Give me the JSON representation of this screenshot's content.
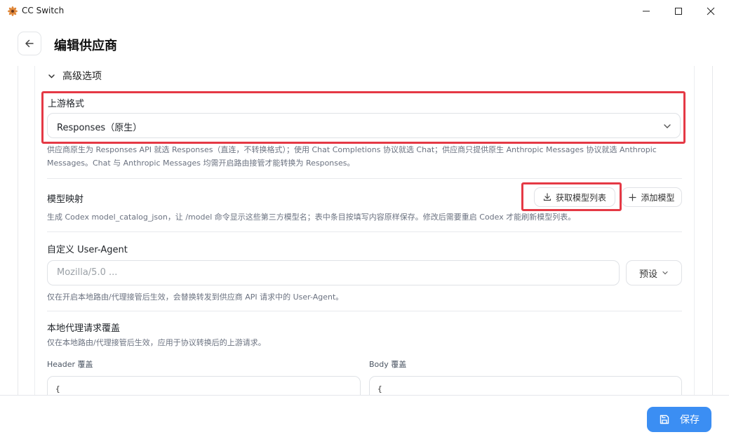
{
  "window": {
    "title": "CC Switch"
  },
  "header": {
    "title": "编辑供应商"
  },
  "advanced": {
    "label": "高级选项"
  },
  "upstream": {
    "label": "上游格式",
    "selected": "Responses（原生）",
    "hint_line1": "供应商原生为 Responses API 就选 Responses（直连，不转换格式）；使用 Chat Completions 协议就选 Chat；供应商只提供原生 Anthropic Messages 协议就选 Anthropic",
    "hint_line2": "Messages。Chat 与 Anthropic Messages 均需开启路由接管才能转换为 Responses。"
  },
  "model_mapping": {
    "label": "模型映射",
    "fetch_label": "获取模型列表",
    "add_label": "添加模型",
    "hint": "生成 Codex model_catalog_json，让 /model 命令显示这些第三方模型名；表中条目按填写内容原样保存。修改后需要重启 Codex 才能刷新模型列表。"
  },
  "user_agent": {
    "label": "自定义 User-Agent",
    "placeholder": "Mozilla/5.0 ...",
    "preset_label": "预设",
    "hint": "仅在开启本地路由/代理接管后生效，会替换转发到供应商 API 请求中的 User-Agent。"
  },
  "proxy_override": {
    "label": "本地代理请求覆盖",
    "hint": "仅在本地路由/代理接管后生效，应用于协议转换后的上游请求。",
    "header_label": "Header 覆盖",
    "header_value": "{",
    "body_label": "Body 覆盖",
    "body_value": "{"
  },
  "footer": {
    "save_label": "保存"
  },
  "colors": {
    "accent": "#3b8ef3",
    "highlight": "#e53945"
  },
  "icons": [
    "app-logo-icon",
    "minimize-icon",
    "maximize-icon",
    "close-icon",
    "arrow-left-icon",
    "chevron-down-icon",
    "download-icon",
    "plus-icon",
    "save-icon"
  ]
}
